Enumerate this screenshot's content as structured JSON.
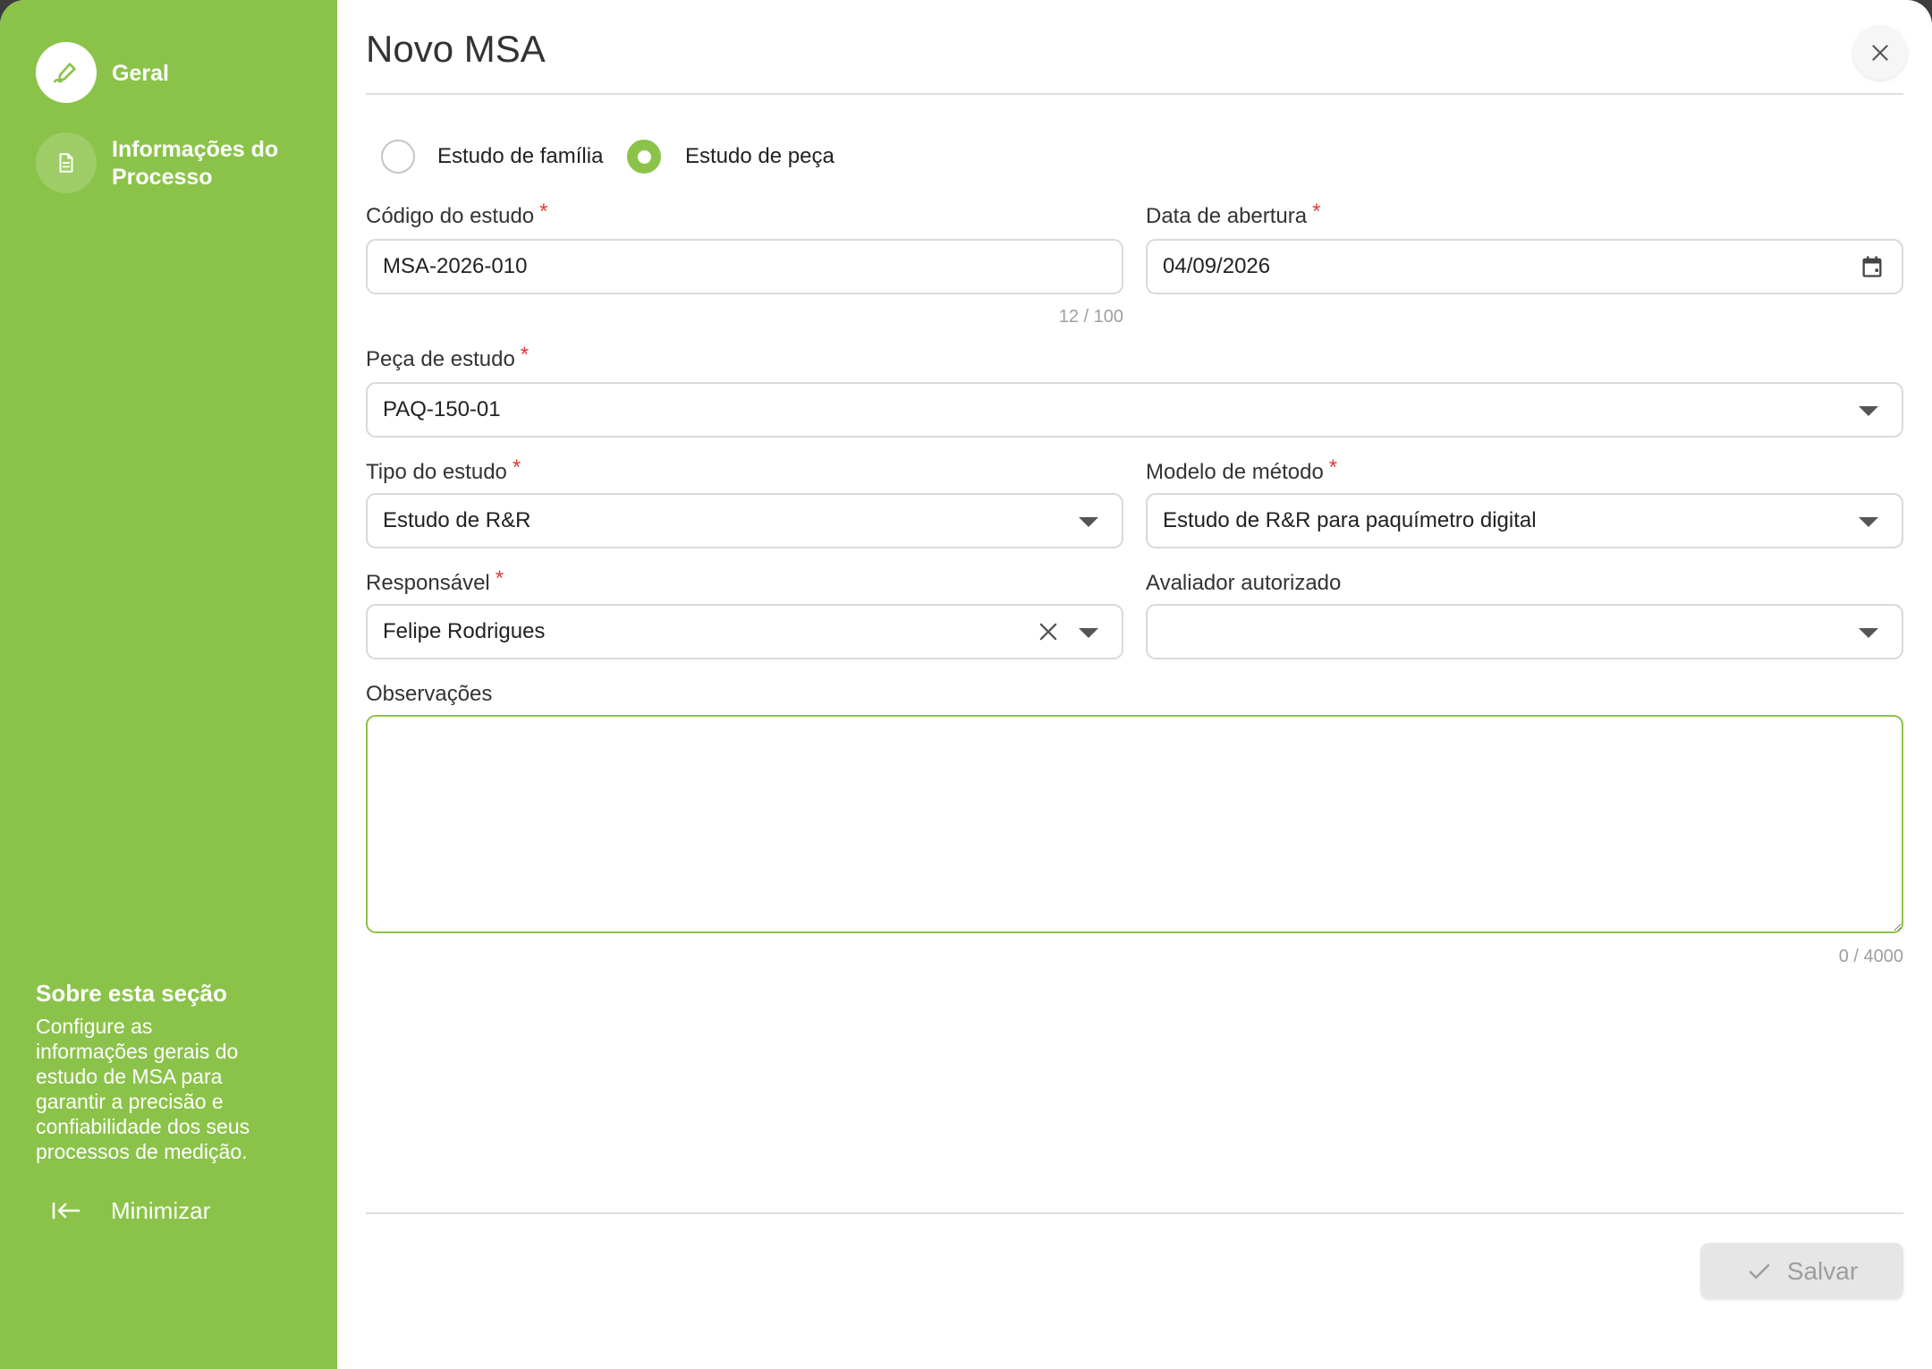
{
  "colors": {
    "brand_green": "#8bc34a",
    "required_mark": "#e53935",
    "text": "#333333",
    "muted": "#9e9e9e",
    "border": "#d9d9d9"
  },
  "sidebar": {
    "steps": [
      {
        "label": "Geral",
        "icon": "pencil-icon",
        "active": true
      },
      {
        "label": "Informações do Processo",
        "icon": "document-icon",
        "active": false
      }
    ],
    "about": {
      "title": "Sobre esta seção",
      "text": "Configure as informações gerais do estudo de MSA para garantir a precisão e confiabilidade dos seus processos de medição."
    },
    "minimize": {
      "label": "Minimizar",
      "icon": "collapse-left-icon"
    }
  },
  "header": {
    "title": "Novo MSA",
    "close_icon": "close-icon"
  },
  "form": {
    "study_scope": {
      "options": [
        {
          "label": "Estudo de família",
          "checked": false
        },
        {
          "label": "Estudo de peça",
          "checked": true
        }
      ]
    },
    "study_code": {
      "label": "Código do estudo",
      "required": "*",
      "value": "MSA-2026-010",
      "counter": "12 / 100"
    },
    "opening_date": {
      "label": "Data de abertura",
      "required": "*",
      "value": "04/09/2026",
      "icon": "calendar-icon"
    },
    "part": {
      "label": "Peça de estudo",
      "required": "*",
      "value": "PAQ-150-01"
    },
    "study_type": {
      "label": "Tipo do estudo",
      "required": "*",
      "value": "Estudo de R&R"
    },
    "method_model": {
      "label": "Modelo de método",
      "required": "*",
      "value": "Estudo de R&R para paquímetro digital"
    },
    "responsible": {
      "label": "Responsável",
      "required": "*",
      "value": "Felipe Rodrigues"
    },
    "authorized_appraiser": {
      "label": "Avaliador autorizado"
    },
    "notes": {
      "label": "Observações",
      "counter": "0 / 4000"
    }
  },
  "footer": {
    "save_label": "Salvar",
    "save_icon": "check-icon"
  }
}
